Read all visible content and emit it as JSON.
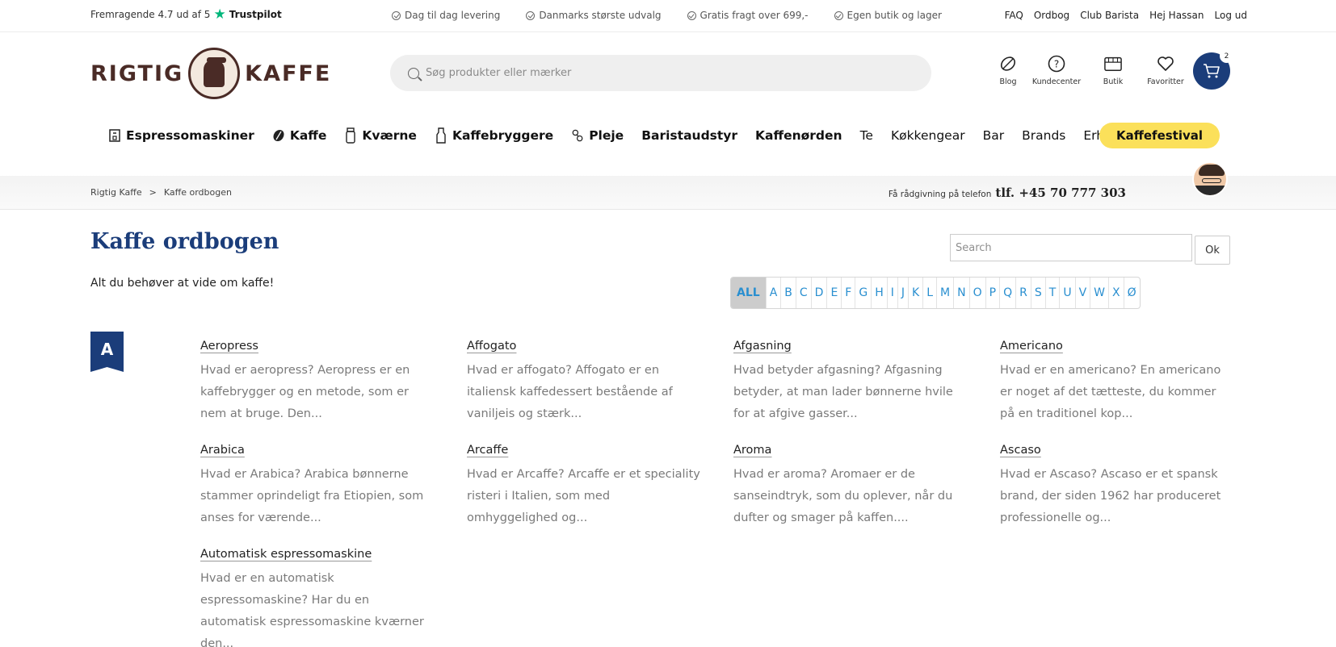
{
  "topbar": {
    "trustpilot_text": "Fremragende 4.7 ud af 5",
    "trustpilot_brand": "Trustpilot",
    "usps": [
      "Dag til dag levering",
      "Danmarks største udvalg",
      "Gratis fragt over 699,-",
      "Egen butik og lager"
    ],
    "links": [
      "FAQ",
      "Ordbog",
      "Club Barista",
      "Hej Hassan",
      "Log ud"
    ]
  },
  "header": {
    "logo_left": "RIGTIG",
    "logo_right": "KAFFE",
    "search_placeholder": "Søg produkter eller mærker",
    "icons": {
      "blog": "Blog",
      "kundecenter": "Kundecenter",
      "butik": "Butik",
      "favoritter": "Favoritter"
    },
    "cart_count": "2"
  },
  "nav": {
    "items": [
      {
        "label": "Espressomaskiner",
        "icon": "espresso-machine-icon"
      },
      {
        "label": "Kaffe",
        "icon": "coffee-bean-icon"
      },
      {
        "label": "Kværne",
        "icon": "grinder-icon"
      },
      {
        "label": "Kaffebryggere",
        "icon": "brewer-icon"
      },
      {
        "label": "Pleje",
        "icon": "care-icon"
      },
      {
        "label": "Baristaudstyr"
      },
      {
        "label": "Kaffenørden"
      },
      {
        "label": "Te"
      },
      {
        "label": "Køkkengear"
      },
      {
        "label": "Bar"
      },
      {
        "label": "Brands"
      },
      {
        "label": "Erhverv"
      }
    ],
    "festival": "Kaffefestival"
  },
  "breadcrumb": {
    "items": [
      "Rigtig Kaffe",
      "Kaffe ordbogen"
    ],
    "separator": ">"
  },
  "phone": {
    "label": "Få rådgivning på telefon",
    "number": "tlf. +45 70 777 303"
  },
  "page": {
    "title": "Kaffe ordbogen",
    "subtitle": "Alt du behøver at vide om kaffe!",
    "search_placeholder": "Search",
    "ok_label": "Ok",
    "letters": [
      "ALL",
      "A",
      "B",
      "C",
      "D",
      "E",
      "F",
      "G",
      "H",
      "I",
      "J",
      "K",
      "L",
      "M",
      "N",
      "O",
      "P",
      "Q",
      "R",
      "S",
      "T",
      "U",
      "V",
      "W",
      "X",
      "Ø"
    ],
    "section_letter": "A",
    "entries": [
      {
        "name": "Aeropress",
        "desc": "Hvad er aeropress? Aeropress er en kaffebrygger og en metode, som er nem at bruge. Den..."
      },
      {
        "name": "Affogato",
        "desc": "Hvad er affogato? Affogato er en italiensk kaffedessert bestående af vaniljeis og stærk..."
      },
      {
        "name": "Afgasning",
        "desc": "Hvad betyder afgasning? Afgasning betyder, at man lader bønnerne hvile for at afgive gasser..."
      },
      {
        "name": "Americano",
        "desc": "Hvad er en americano? En americano er noget af det tætteste, du kommer på en traditionel kop..."
      },
      {
        "name": "Arabica",
        "desc": "Hvad er Arabica? Arabica  bønnerne stammer oprindeligt fra Etiopien, som anses for værende..."
      },
      {
        "name": "Arcaffe",
        "desc": "Hvad er Arcaffe? Arcaffe  er et speciality risteri i Italien, som med omhyggelighed og..."
      },
      {
        "name": "Aroma",
        "desc": "Hvad er aroma? Aromaer er de sanseindtryk, som du oplever, når du dufter og smager på kaffen...."
      },
      {
        "name": "Ascaso",
        "desc": "Hvad er Ascaso? Ascaso er et spansk brand, der siden 1962 har produceret professionelle og..."
      },
      {
        "name": "Automatisk espressomaskine",
        "desc": "Hvad er en automatisk espressomaskine? Har du en automatisk espressomaskine kværner den..."
      }
    ]
  },
  "colors": {
    "brand_blue": "#1b3d7a",
    "logo_brown": "#4a2b26",
    "festival_yellow": "#fbe05a",
    "letter_link": "#2a8fd0",
    "trustpilot_green": "#00b67a"
  }
}
